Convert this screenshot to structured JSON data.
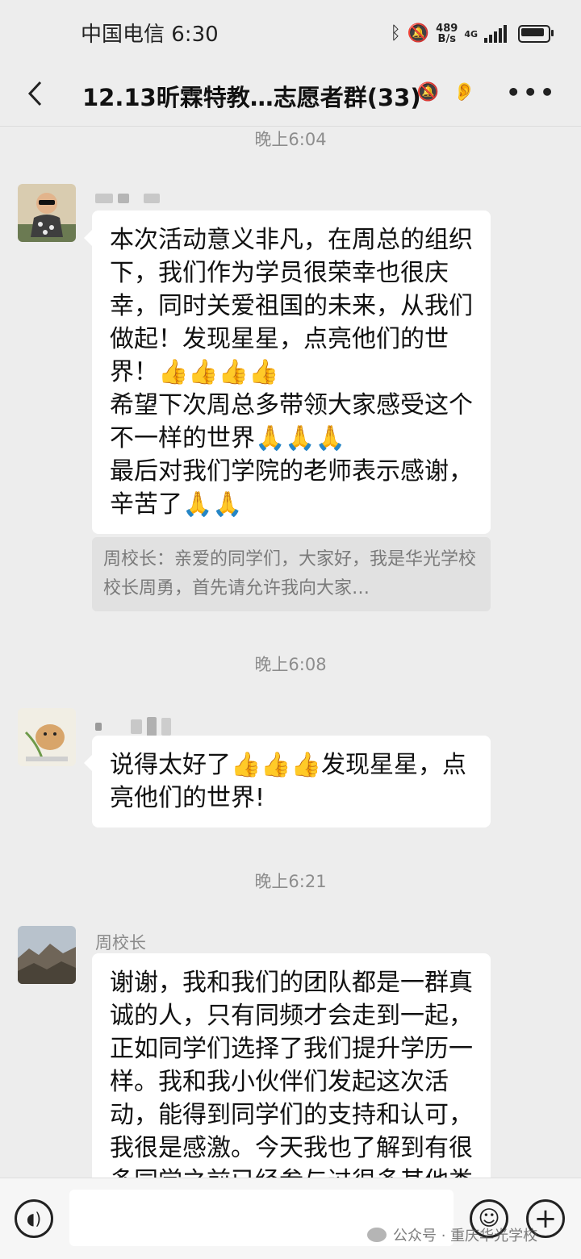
{
  "status_bar": {
    "carrier_time": "中国电信 6:30",
    "net_speed_value": "489",
    "net_speed_unit": "B/s",
    "network_type": "4G"
  },
  "header": {
    "title": "12.13昕霖特教…志愿者群(33)",
    "more": "•••"
  },
  "messages": [
    {
      "timestamp": "晚上6:04",
      "paragraphs": [
        "本次活动意义非凡，在周总的组织下，我们作为学员很荣幸也很庆幸，同时关爱祖国的未来，从我们做起！发现星星，点亮他们的世界！👍👍👍👍",
        "希望下次周总多带领大家感受这个不一样的世界🙏🙏🙏",
        "最后对我们学院的老师表示感谢，辛苦了🙏🙏"
      ],
      "quote": "周校长：亲爱的同学们，大家好，我是华光学校校长周勇，首先请允许我向大家…"
    },
    {
      "timestamp": "晚上6:08",
      "text": "说得太好了👍👍👍发现星星，点亮他们的世界!"
    },
    {
      "timestamp": "晚上6:21",
      "sender": "周校长",
      "text": "谢谢，我和我们的团队都是一群真诚的人，只有同频才会走到一起，正如同学们选择了我们提升学历一样。我和我小伙伴们发起这次活动，能得到同学们的支持和认可，我很是感激。今天我也了解到有很多同学之前已经参与过很多其他类"
    }
  ],
  "watermark": "公众号 · 重庆华光学校",
  "icons": {
    "voice": "voice-icon",
    "emoji": "emoji-icon",
    "plus": "plus-icon"
  }
}
